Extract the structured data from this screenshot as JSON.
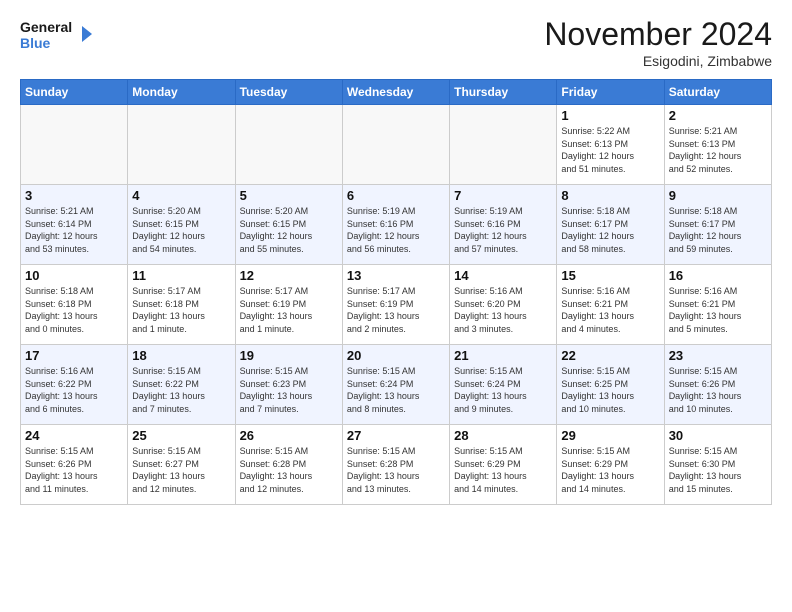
{
  "logo": {
    "line1": "General",
    "line2": "Blue"
  },
  "title": "November 2024",
  "location": "Esigodini, Zimbabwe",
  "weekdays": [
    "Sunday",
    "Monday",
    "Tuesday",
    "Wednesday",
    "Thursday",
    "Friday",
    "Saturday"
  ],
  "weeks": [
    [
      {
        "day": "",
        "info": ""
      },
      {
        "day": "",
        "info": ""
      },
      {
        "day": "",
        "info": ""
      },
      {
        "day": "",
        "info": ""
      },
      {
        "day": "",
        "info": ""
      },
      {
        "day": "1",
        "info": "Sunrise: 5:22 AM\nSunset: 6:13 PM\nDaylight: 12 hours\nand 51 minutes."
      },
      {
        "day": "2",
        "info": "Sunrise: 5:21 AM\nSunset: 6:13 PM\nDaylight: 12 hours\nand 52 minutes."
      }
    ],
    [
      {
        "day": "3",
        "info": "Sunrise: 5:21 AM\nSunset: 6:14 PM\nDaylight: 12 hours\nand 53 minutes."
      },
      {
        "day": "4",
        "info": "Sunrise: 5:20 AM\nSunset: 6:15 PM\nDaylight: 12 hours\nand 54 minutes."
      },
      {
        "day": "5",
        "info": "Sunrise: 5:20 AM\nSunset: 6:15 PM\nDaylight: 12 hours\nand 55 minutes."
      },
      {
        "day": "6",
        "info": "Sunrise: 5:19 AM\nSunset: 6:16 PM\nDaylight: 12 hours\nand 56 minutes."
      },
      {
        "day": "7",
        "info": "Sunrise: 5:19 AM\nSunset: 6:16 PM\nDaylight: 12 hours\nand 57 minutes."
      },
      {
        "day": "8",
        "info": "Sunrise: 5:18 AM\nSunset: 6:17 PM\nDaylight: 12 hours\nand 58 minutes."
      },
      {
        "day": "9",
        "info": "Sunrise: 5:18 AM\nSunset: 6:17 PM\nDaylight: 12 hours\nand 59 minutes."
      }
    ],
    [
      {
        "day": "10",
        "info": "Sunrise: 5:18 AM\nSunset: 6:18 PM\nDaylight: 13 hours\nand 0 minutes."
      },
      {
        "day": "11",
        "info": "Sunrise: 5:17 AM\nSunset: 6:18 PM\nDaylight: 13 hours\nand 1 minute."
      },
      {
        "day": "12",
        "info": "Sunrise: 5:17 AM\nSunset: 6:19 PM\nDaylight: 13 hours\nand 1 minute."
      },
      {
        "day": "13",
        "info": "Sunrise: 5:17 AM\nSunset: 6:19 PM\nDaylight: 13 hours\nand 2 minutes."
      },
      {
        "day": "14",
        "info": "Sunrise: 5:16 AM\nSunset: 6:20 PM\nDaylight: 13 hours\nand 3 minutes."
      },
      {
        "day": "15",
        "info": "Sunrise: 5:16 AM\nSunset: 6:21 PM\nDaylight: 13 hours\nand 4 minutes."
      },
      {
        "day": "16",
        "info": "Sunrise: 5:16 AM\nSunset: 6:21 PM\nDaylight: 13 hours\nand 5 minutes."
      }
    ],
    [
      {
        "day": "17",
        "info": "Sunrise: 5:16 AM\nSunset: 6:22 PM\nDaylight: 13 hours\nand 6 minutes."
      },
      {
        "day": "18",
        "info": "Sunrise: 5:15 AM\nSunset: 6:22 PM\nDaylight: 13 hours\nand 7 minutes."
      },
      {
        "day": "19",
        "info": "Sunrise: 5:15 AM\nSunset: 6:23 PM\nDaylight: 13 hours\nand 7 minutes."
      },
      {
        "day": "20",
        "info": "Sunrise: 5:15 AM\nSunset: 6:24 PM\nDaylight: 13 hours\nand 8 minutes."
      },
      {
        "day": "21",
        "info": "Sunrise: 5:15 AM\nSunset: 6:24 PM\nDaylight: 13 hours\nand 9 minutes."
      },
      {
        "day": "22",
        "info": "Sunrise: 5:15 AM\nSunset: 6:25 PM\nDaylight: 13 hours\nand 10 minutes."
      },
      {
        "day": "23",
        "info": "Sunrise: 5:15 AM\nSunset: 6:26 PM\nDaylight: 13 hours\nand 10 minutes."
      }
    ],
    [
      {
        "day": "24",
        "info": "Sunrise: 5:15 AM\nSunset: 6:26 PM\nDaylight: 13 hours\nand 11 minutes."
      },
      {
        "day": "25",
        "info": "Sunrise: 5:15 AM\nSunset: 6:27 PM\nDaylight: 13 hours\nand 12 minutes."
      },
      {
        "day": "26",
        "info": "Sunrise: 5:15 AM\nSunset: 6:28 PM\nDaylight: 13 hours\nand 12 minutes."
      },
      {
        "day": "27",
        "info": "Sunrise: 5:15 AM\nSunset: 6:28 PM\nDaylight: 13 hours\nand 13 minutes."
      },
      {
        "day": "28",
        "info": "Sunrise: 5:15 AM\nSunset: 6:29 PM\nDaylight: 13 hours\nand 14 minutes."
      },
      {
        "day": "29",
        "info": "Sunrise: 5:15 AM\nSunset: 6:29 PM\nDaylight: 13 hours\nand 14 minutes."
      },
      {
        "day": "30",
        "info": "Sunrise: 5:15 AM\nSunset: 6:30 PM\nDaylight: 13 hours\nand 15 minutes."
      }
    ]
  ]
}
